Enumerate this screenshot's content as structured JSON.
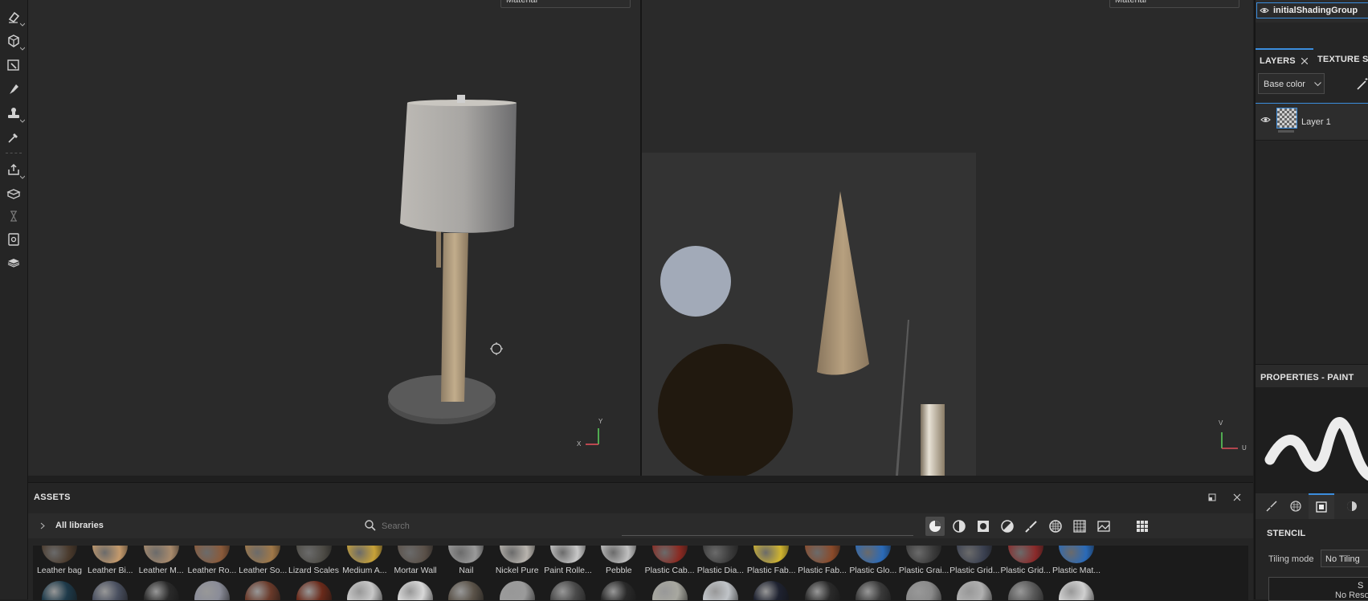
{
  "toolbar": {
    "tools": [
      {
        "name": "eraser-icon"
      },
      {
        "name": "projection-icon"
      },
      {
        "name": "polygon-fill-icon"
      },
      {
        "name": "smudge-icon"
      },
      {
        "name": "clone-stamp-icon"
      },
      {
        "name": "color-picker-icon"
      },
      {
        "name": "export-icon"
      },
      {
        "name": "bake-icon"
      },
      {
        "name": "hourglass-icon"
      },
      {
        "name": "document-icon"
      },
      {
        "name": "display-settings-icon"
      }
    ]
  },
  "viewport3d": {
    "material_select": "Material",
    "axis_x": "X",
    "axis_y": "Y"
  },
  "viewport2d": {
    "material_select": "Material",
    "axis_u": "U",
    "axis_v": "V"
  },
  "assets": {
    "title": "ASSETS",
    "breadcrumb": "All libraries",
    "search_placeholder": "Search",
    "materials": [
      {
        "label": "Leather bag",
        "color": "#4a3a2c"
      },
      {
        "label": "Leather Bi...",
        "color": "#c49a6c"
      },
      {
        "label": "Leather M...",
        "color": "#a88a6c"
      },
      {
        "label": "Leather Ro...",
        "color": "#8a5a3a"
      },
      {
        "label": "Leather So...",
        "color": "#a07848"
      },
      {
        "label": "Lizard Scales",
        "color": "#4c4a44"
      },
      {
        "label": "Medium A...",
        "color": "#c8a238"
      },
      {
        "label": "Mortar Wall",
        "color": "#5a5048"
      },
      {
        "label": "Nail",
        "color": "#9a9a9a"
      },
      {
        "label": "Nickel Pure",
        "color": "#b8b4ae"
      },
      {
        "label": "Paint Rolle...",
        "color": "#c8c8c8"
      },
      {
        "label": "Pebble",
        "color": "#c0c0c0"
      },
      {
        "label": "Plastic Cab...",
        "color": "#8a2a22"
      },
      {
        "label": "Plastic Dia...",
        "color": "#3a3a3a"
      },
      {
        "label": "Plastic Fab...",
        "color": "#d0b430"
      },
      {
        "label": "Plastic Fab...",
        "color": "#8a4a2a"
      },
      {
        "label": "Plastic Glo...",
        "color": "#2a6ab8"
      },
      {
        "label": "Plastic Grai...",
        "color": "#3a3a3a"
      },
      {
        "label": "Plastic Grid...",
        "color": "#3a4050"
      },
      {
        "label": "Plastic Grid...",
        "color": "#8a2a2a"
      },
      {
        "label": "Plastic Mat...",
        "color": "#2a6ab8"
      }
    ],
    "materials_row2": [
      "#1e3a4a",
      "#4a5060",
      "#2a2a2a",
      "#8a8c98",
      "#6a3a2a",
      "#6a2a1a",
      "#c8c8c8",
      "#d8d8d8",
      "#5a5248",
      "#9a9a9a",
      "#4a4a4a",
      "#2a2a2a",
      "#a8a8a0",
      "#c0c4c8",
      "#1e2230",
      "#2a2a2a",
      "#3a3a3a",
      "#8a8a8a",
      "#b0b0b0",
      "#5a5a5a",
      "#d0d0d0"
    ]
  },
  "right_panel": {
    "shading_group": "initialShadingGroup",
    "tabs": [
      "LAYERS",
      "TEXTURE S"
    ],
    "channel_select": "Base color",
    "layer_name": "Layer 1",
    "properties_title": "PROPERTIES - PAINT",
    "stencil_title": "STENCIL",
    "tiling_label": "Tiling mode",
    "tiling_value": "No Tiling",
    "resource_label": "No Reso",
    "resource_top": "S"
  },
  "colors": {
    "accent": "#3b8ddd",
    "panel": "#252525",
    "viewport": "#2a2a2a"
  }
}
